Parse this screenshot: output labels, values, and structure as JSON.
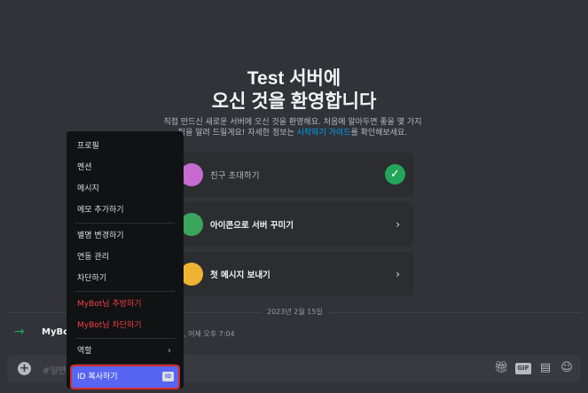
{
  "welcome": {
    "title_line1": "Test 서버에",
    "title_line2": "오신 것을 환영합니다",
    "desc_part1": "직접 만드신 새로운 서버에 오신 것을 환영해요. 처음에 알아두면 좋을 몇 가지 팁을 알려 드릴게요! 자세한 정보는 ",
    "desc_link": "시작하기 가이드",
    "desc_part2": "를 확인해보세요."
  },
  "cards": [
    {
      "label": "친구 초대하기",
      "done": true,
      "icon": "invite-icon",
      "icon_color": "#c76bd0"
    },
    {
      "label": "아이콘으로 서버 꾸미기",
      "done": false,
      "icon": "palette-icon",
      "icon_color": "#3ba55d"
    },
    {
      "label": "첫 메시지 보내기",
      "done": false,
      "icon": "message-icon",
      "icon_color": "#f0b232"
    }
  ],
  "timeline": {
    "date": "2023년 2월 15일",
    "join_name": "MyBo",
    "join_time": ", 어제 오후 7:04"
  },
  "composer": {
    "placeholder": "#일반",
    "tools": [
      "gift-icon",
      "gif-icon",
      "sticker-icon",
      "emoji-icon"
    ],
    "gif_label": "GIF"
  },
  "context_menu": {
    "group1": [
      "프로필",
      "멘션",
      "메시지",
      "메모 추가하기"
    ],
    "group2": [
      "별명 변경하기",
      "연동 관리",
      "차단하기"
    ],
    "group3": [
      "MyBot님 추방하기",
      "MyBot님 차단하기"
    ],
    "roles": "역할",
    "copy_id": "ID 복사하기",
    "copy_id_badge": "ID"
  },
  "colors": {
    "background": "#313338",
    "accent": "#5865f2",
    "danger": "#f23f42",
    "success": "#23a55a",
    "link": "#00a8fc"
  }
}
